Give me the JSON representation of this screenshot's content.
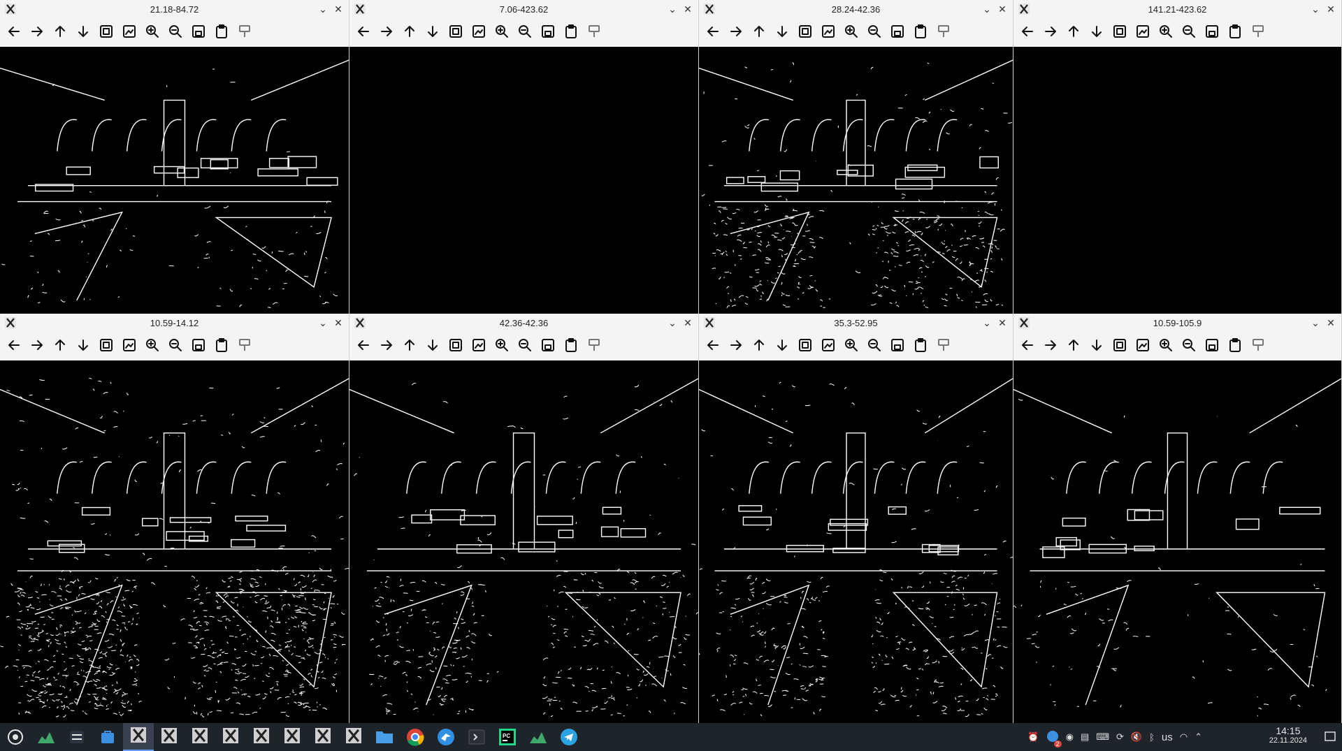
{
  "windows": [
    {
      "title": "21.18-84.72",
      "density": "low"
    },
    {
      "title": "7.06-423.62",
      "density": "empty"
    },
    {
      "title": "28.24-42.36",
      "density": "medium"
    },
    {
      "title": "141.21-423.62",
      "density": "empty"
    },
    {
      "title": "10.59-14.12",
      "density": "high"
    },
    {
      "title": "42.36-42.36",
      "density": "medium"
    },
    {
      "title": "35.3-52.95",
      "density": "medium"
    },
    {
      "title": "10.59-105.9",
      "density": "low"
    }
  ],
  "toolbar_icons": [
    "arrow-left-icon",
    "arrow-right-icon",
    "arrow-up-icon",
    "arrow-down-icon",
    "image-fit-icon",
    "image-settings-icon",
    "zoom-in-icon",
    "zoom-out-icon",
    "save-icon",
    "clipboard-icon",
    "brush-icon"
  ],
  "taskbar": {
    "time": "14:15",
    "date": "22.11.2024",
    "keyboard_layout": "us",
    "notification_count": "2"
  },
  "colors": {
    "taskbar_bg": "#1f232a",
    "window_bg": "#f4f4f5",
    "canvas_bg": "#000000",
    "edge_color": "#ffffff"
  }
}
